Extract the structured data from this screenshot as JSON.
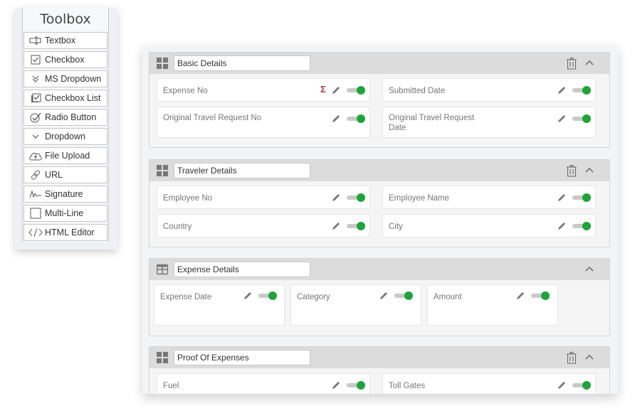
{
  "toolbox": {
    "title": "Toolbox",
    "items": [
      {
        "label": "Textbox",
        "icon": "textbox-icon"
      },
      {
        "label": "Checkbox",
        "icon": "checkbox-icon"
      },
      {
        "label": "MS Dropdown",
        "icon": "double-chevron-down-icon"
      },
      {
        "label": "Checkbox List",
        "icon": "checkbox-list-icon"
      },
      {
        "label": "Radio Button",
        "icon": "radio-check-icon"
      },
      {
        "label": "Dropdown",
        "icon": "chevron-down-icon"
      },
      {
        "label": "File Upload",
        "icon": "cloud-upload-icon"
      },
      {
        "label": "URL",
        "icon": "link-icon"
      },
      {
        "label": "Signature",
        "icon": "signature-icon"
      },
      {
        "label": "Multi-Line",
        "icon": "empty-box-icon"
      },
      {
        "label": "HTML Editor",
        "icon": "code-icon"
      }
    ]
  },
  "sections": [
    {
      "title": "Basic Details",
      "grip_icon": "grid-four-icon",
      "fields": [
        {
          "label": "Expense No",
          "has_sigma": true,
          "sigma": "Σ",
          "enabled": true
        },
        {
          "label": "Submitted Date",
          "enabled": true
        },
        {
          "label": "Original Travel Request No",
          "enabled": true
        },
        {
          "label": "Original Travel Request Date",
          "enabled": true
        }
      ]
    },
    {
      "title": "Traveler Details",
      "grip_icon": "grid-four-icon",
      "fields": [
        {
          "label": "Employee No",
          "enabled": true
        },
        {
          "label": "Employee Name",
          "enabled": true
        },
        {
          "label": "Country",
          "enabled": true
        },
        {
          "label": "City",
          "enabled": true
        }
      ]
    },
    {
      "title": "Expense Details",
      "grip_icon": "table-icon",
      "fields": [
        {
          "label": "Expense Date",
          "enabled": true
        },
        {
          "label": "Category",
          "enabled": true
        },
        {
          "label": "Amount",
          "enabled": true
        }
      ]
    },
    {
      "title": "Proof Of Expenses",
      "grip_icon": "grid-four-icon",
      "fields": [
        {
          "label": "Fuel",
          "enabled": true
        },
        {
          "label": "Toll Gates",
          "enabled": true
        }
      ]
    }
  ],
  "colors": {
    "toggle_on": "#1ea43a",
    "sigma": "#c0392b",
    "header_bg": "#dcdcdc"
  }
}
